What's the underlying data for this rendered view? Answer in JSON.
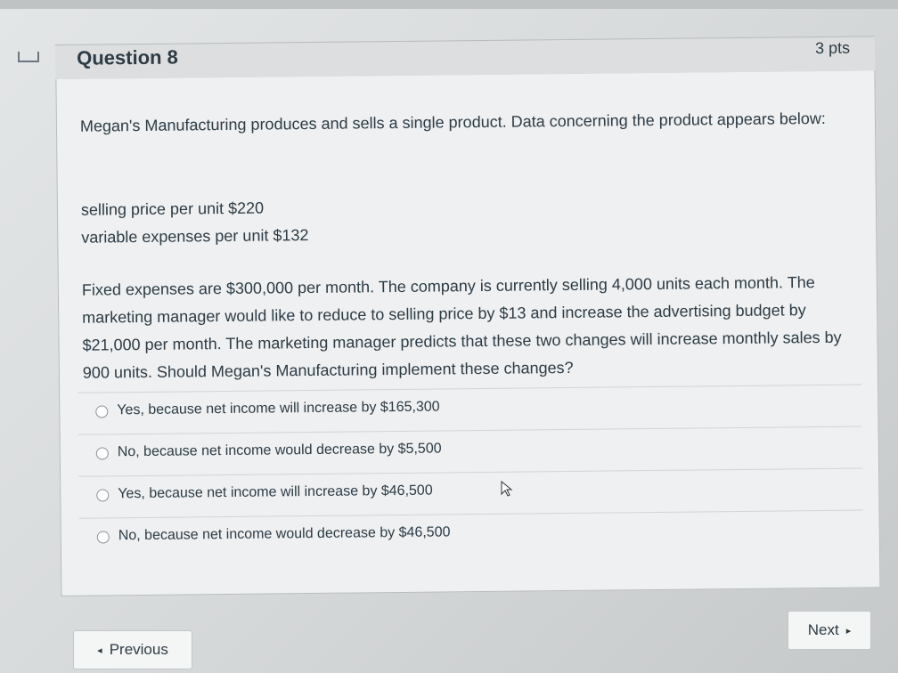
{
  "question": {
    "title": "Question 8",
    "points": "3 pts",
    "intro": "Megan's Manufacturing produces and sells a single product. Data concerning the product appears below:",
    "data_lines": [
      "selling price per unit $220",
      "variable expenses per unit $132"
    ],
    "scenario": "Fixed expenses are $300,000 per month. The company is currently selling 4,000 units each month. The marketing manager would like to reduce to selling price by $13 and increase the advertising budget by $21,000 per month. The marketing manager predicts that these two changes will increase monthly sales by 900 units. Should Megan's Manufacturing implement these changes?",
    "answers": [
      "Yes, because net income will increase by $165,300",
      "No, because net income would decrease by $5,500",
      "Yes, because net income will increase by $46,500",
      "No, because net income would decrease by $46,500"
    ]
  },
  "nav": {
    "previous_label": "Previous",
    "next_label": "Next",
    "previous_arrow": "◂",
    "next_arrow": "▸"
  },
  "icons": {
    "flag": "flag-icon",
    "cursor": "cursor-icon",
    "radio": "radio-button"
  }
}
